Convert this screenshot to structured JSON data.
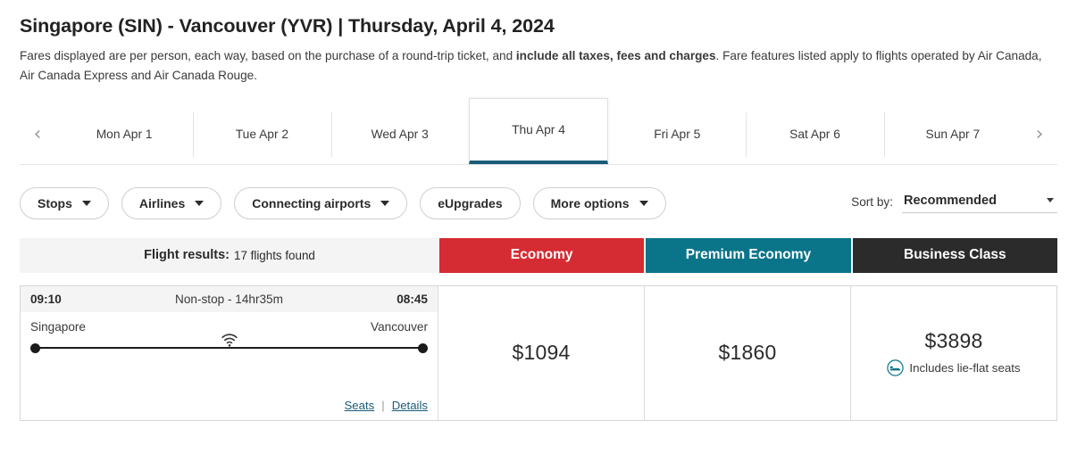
{
  "header": {
    "title": "Singapore (SIN) - Vancouver (YVR) | Thursday, April 4, 2024",
    "note_part1": "Fares displayed are per person, each way, based on the purchase of a round-trip ticket, and ",
    "note_bold": "include all taxes, fees and charges",
    "note_part2": ". Fare features listed apply to flights operated by Air Canada, Air Canada Express and Air Canada Rouge."
  },
  "date_strip": {
    "prev_label": "‹",
    "next_label": "›",
    "tabs": [
      {
        "label": "Mon Apr 1",
        "active": false
      },
      {
        "label": "Tue Apr 2",
        "active": false
      },
      {
        "label": "Wed Apr 3",
        "active": false
      },
      {
        "label": "Thu Apr 4",
        "active": true
      },
      {
        "label": "Fri Apr 5",
        "active": false
      },
      {
        "label": "Sat Apr 6",
        "active": false
      },
      {
        "label": "Sun Apr 7",
        "active": false
      }
    ],
    "active_underline_color": "#1a5b79"
  },
  "filters": {
    "pills": [
      {
        "label": "Stops",
        "has_caret": true
      },
      {
        "label": "Airlines",
        "has_caret": true
      },
      {
        "label": "Connecting airports",
        "has_caret": true
      },
      {
        "label": "eUpgrades",
        "has_caret": false
      },
      {
        "label": "More options",
        "has_caret": true
      }
    ],
    "sort_label": "Sort by:",
    "sort_value": "Recommended",
    "sort_options": [
      "Recommended"
    ]
  },
  "results_bar": {
    "results_strong": "Flight results:",
    "results_count": "17 flights found",
    "classes": [
      {
        "label": "Economy",
        "color": "#d52b33"
      },
      {
        "label": "Premium Economy",
        "color": "#0a7489"
      },
      {
        "label": "Business Class",
        "color": "#2b2b2b"
      }
    ]
  },
  "flights": [
    {
      "depart_time": "09:10",
      "duration_text": "Non-stop - 14hr35m",
      "arrive_time": "08:45",
      "origin_city": "Singapore",
      "destination_city": "Vancouver",
      "amenity_icon": "wifi-icon",
      "seats_link": "Seats",
      "details_link": "Details",
      "links_separator": "|",
      "fares": [
        {
          "cabin": "Economy",
          "price": "$1094",
          "perk": "",
          "perk_icon": ""
        },
        {
          "cabin": "Premium Economy",
          "price": "$1860",
          "perk": "",
          "perk_icon": ""
        },
        {
          "cabin": "Business Class",
          "price": "$3898",
          "perk": "Includes lie-flat seats",
          "perk_icon": "lie-flat-seat-icon"
        }
      ]
    }
  ]
}
